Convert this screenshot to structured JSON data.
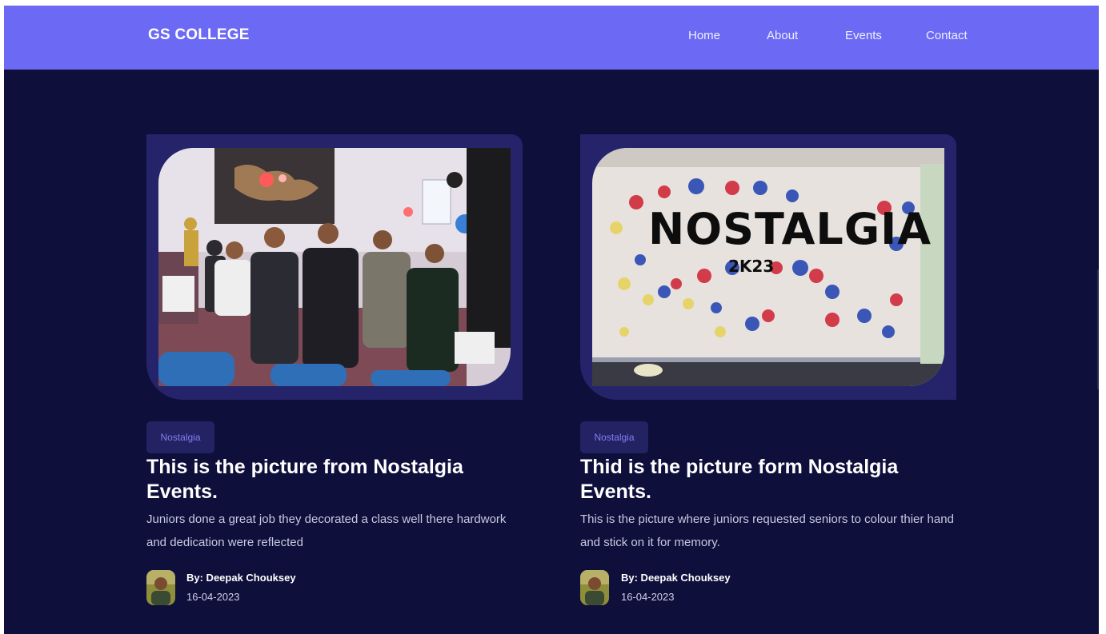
{
  "nav": {
    "brand": "GS COLLEGE",
    "links": [
      "Home",
      "About",
      "Events",
      "Contact"
    ]
  },
  "cards": [
    {
      "tag": "Nostalgia",
      "title": "This is the picture from Nostalgia Events.",
      "description": "Juniors done a great job they decorated a class well there hardwork and dedication were reflected",
      "author": "By: Deepak Chouksey",
      "date": "16-04-2023",
      "image": "group-photo-classroom"
    },
    {
      "tag": "Nostalgia",
      "title": "Thid is the picture form Nostalgia Events.",
      "description": "This is the picture where juniors requested seniors to colour thier hand and stick on it for memory.",
      "author": "By: Deepak Chouksey",
      "date": "16-04-2023",
      "image": "handprint-banner",
      "banner_title": "NOSTALGIA",
      "banner_subtitle": "2K23"
    }
  ],
  "colors": {
    "navbar": "#6c6af4",
    "background": "#0e0f3b",
    "card_frame": "#25246b",
    "tag_bg": "#232262",
    "tag_text": "#7f80f2"
  }
}
